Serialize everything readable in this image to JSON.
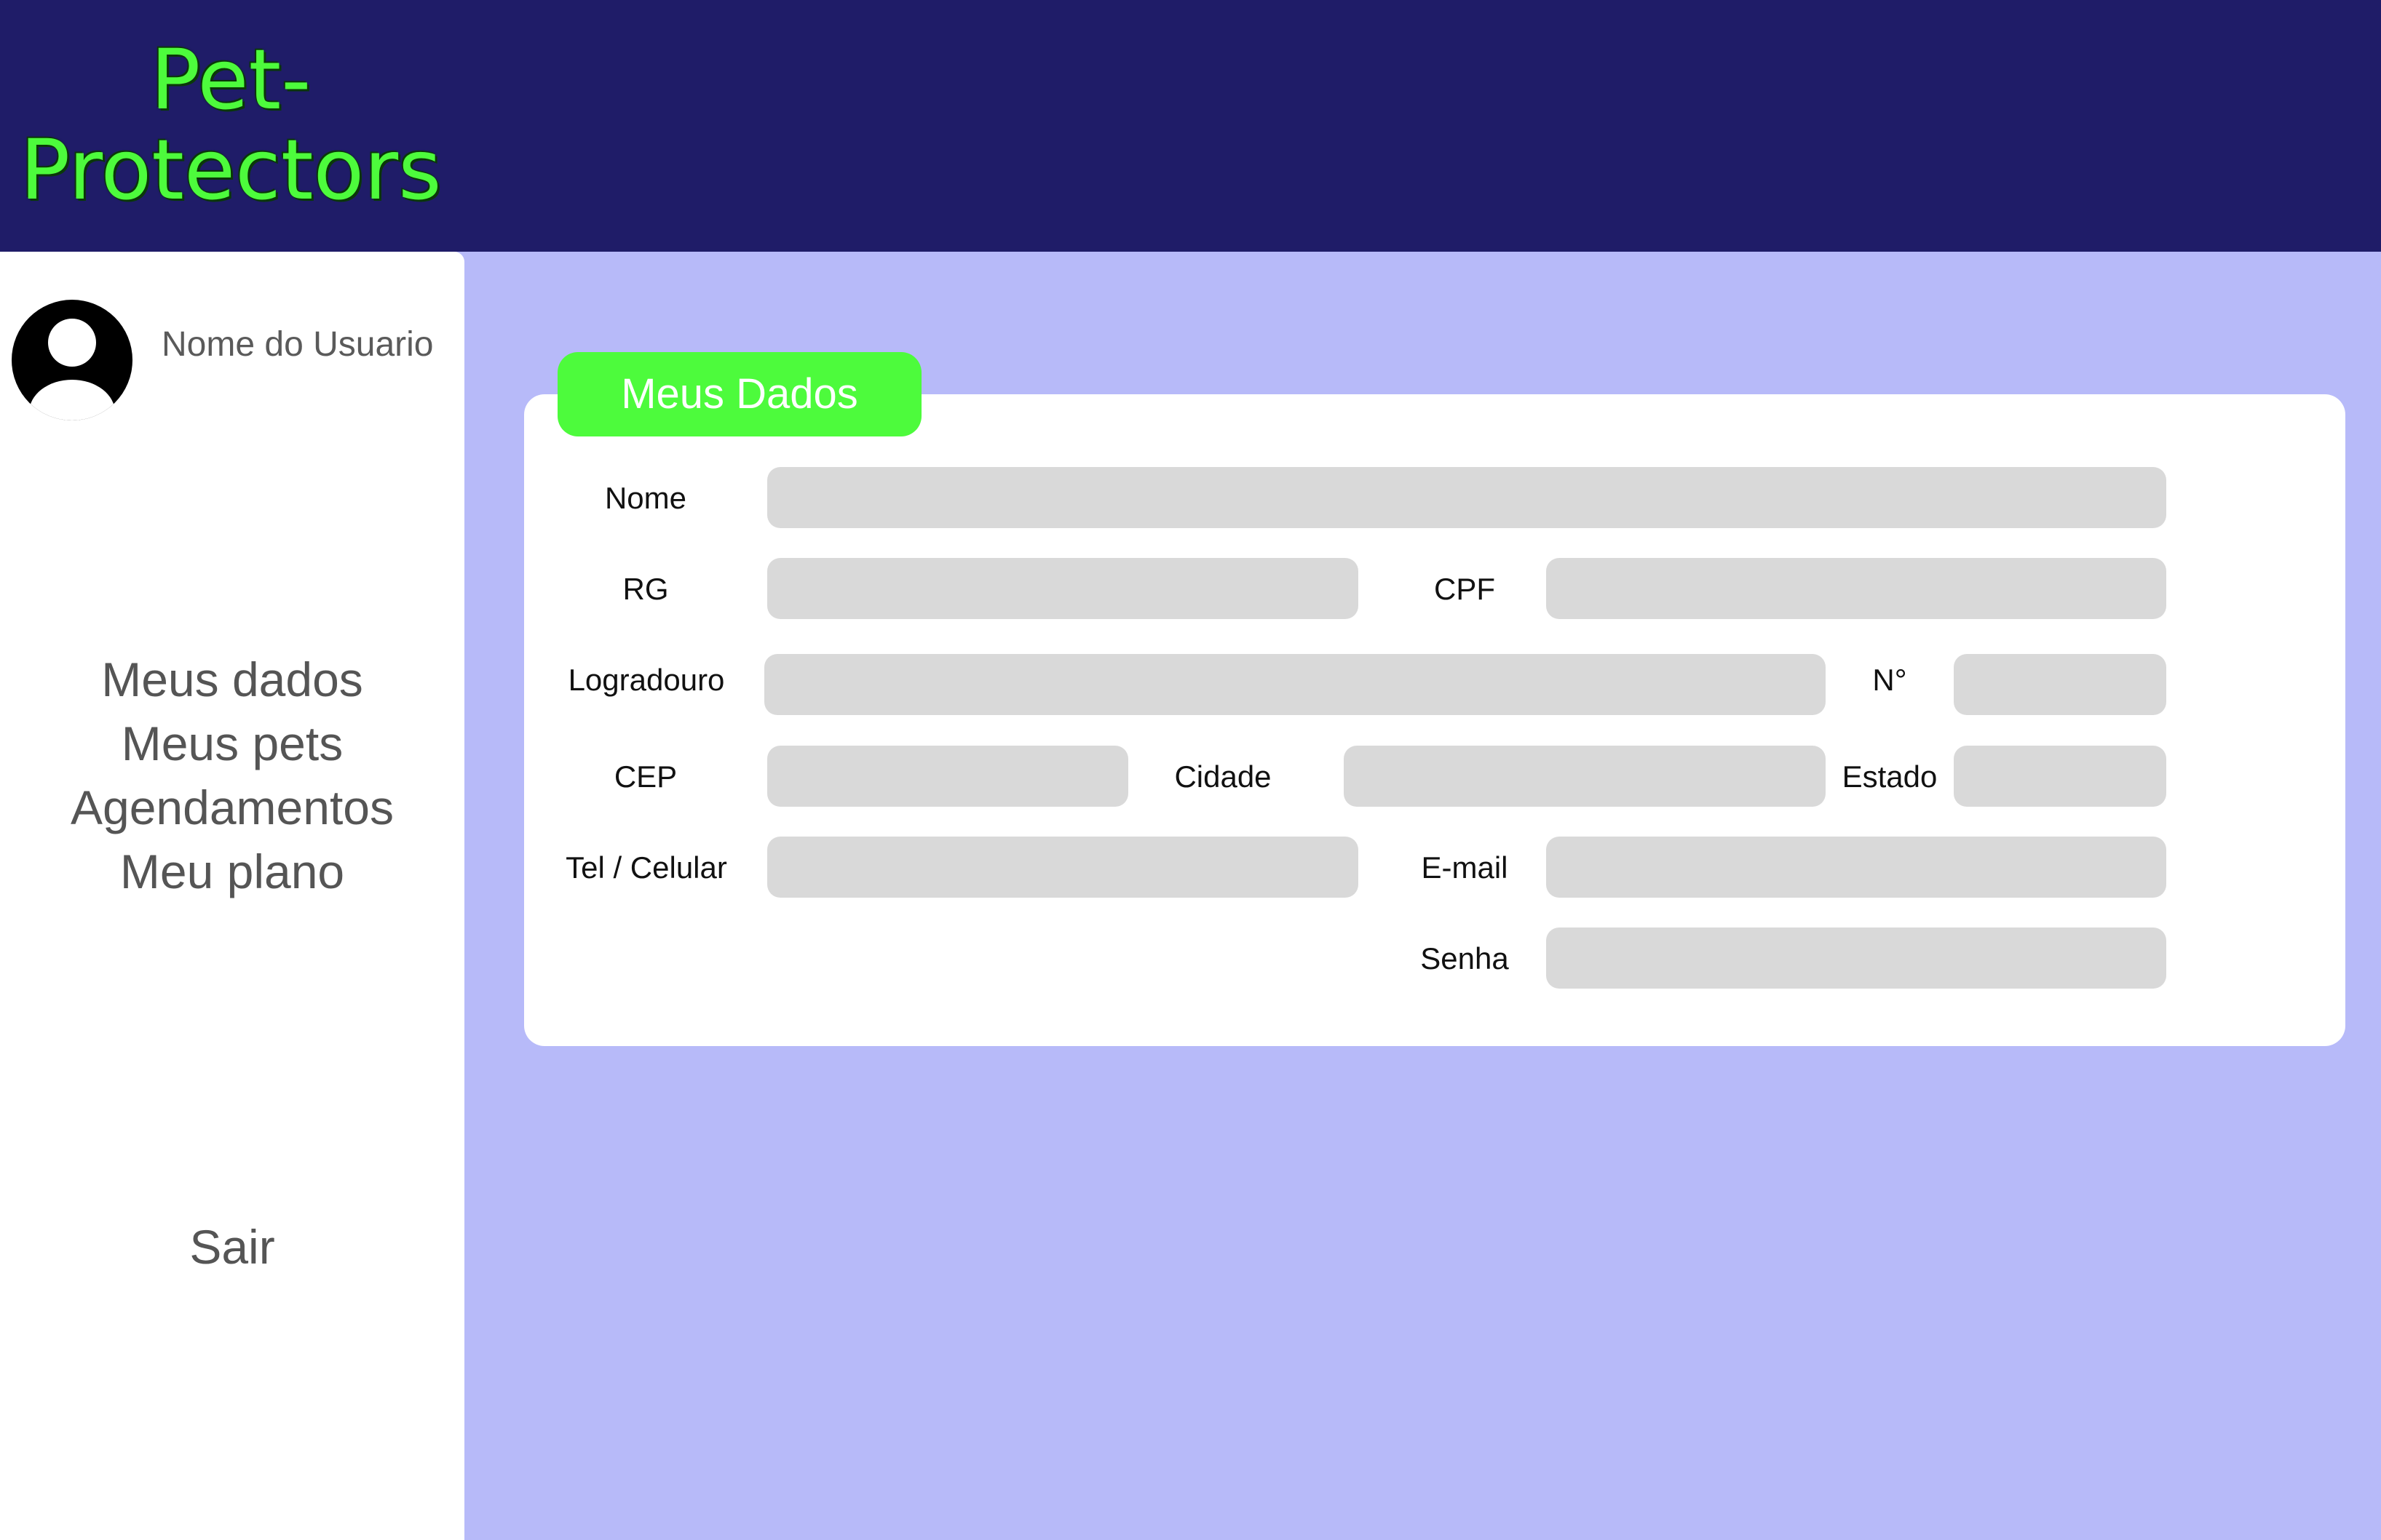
{
  "header": {
    "logo_line1": "Pet-",
    "logo_line2": "Protectors"
  },
  "sidebar": {
    "user_name": "Nome do Usuario",
    "nav": [
      "Meus dados",
      "Meus pets",
      "Agendamentos",
      "Meu plano"
    ],
    "logout": "Sair"
  },
  "form": {
    "title": "Meus Dados",
    "labels": {
      "nome": "Nome",
      "rg": "RG",
      "cpf": "CPF",
      "logradouro": "Logradouro",
      "numero": "N°",
      "cep": "CEP",
      "cidade": "Cidade",
      "estado": "Estado",
      "tel": "Tel / Celular",
      "email": "E-mail",
      "senha": "Senha"
    },
    "values": {
      "nome": "",
      "rg": "",
      "cpf": "",
      "logradouro": "",
      "numero": "",
      "cep": "",
      "cidade": "",
      "estado": "",
      "tel": "",
      "email": "",
      "senha": ""
    }
  },
  "colors": {
    "header_bg": "#1f1c68",
    "page_bg": "#b7baf9",
    "accent_green": "#4dfb3c",
    "field_bg": "#d9d9d9"
  }
}
